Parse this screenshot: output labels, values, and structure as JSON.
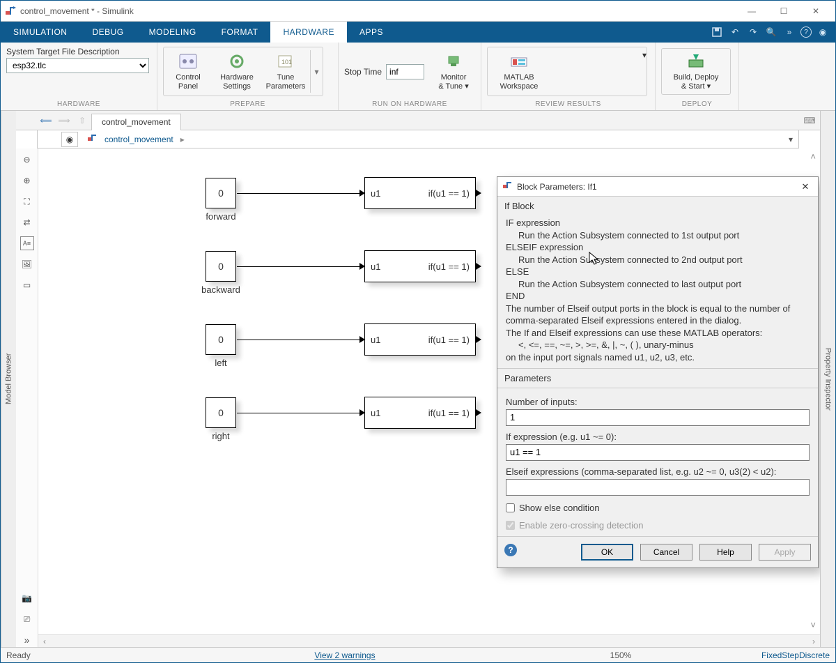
{
  "titlebar": {
    "title": "control_movement * - Simulink"
  },
  "menubar": {
    "tabs": [
      "SIMULATION",
      "DEBUG",
      "MODELING",
      "FORMAT",
      "HARDWARE",
      "APPS"
    ],
    "active": 4
  },
  "ribbon": {
    "hardware": {
      "label": "HARDWARE",
      "field_label": "System Target File Description",
      "field_value": "esp32.tlc"
    },
    "prepare": {
      "label": "PREPARE",
      "btns": [
        {
          "t1": "Control",
          "t2": "Panel"
        },
        {
          "t1": "Hardware",
          "t2": "Settings"
        },
        {
          "t1": "Tune",
          "t2": "Parameters"
        }
      ]
    },
    "run": {
      "label": "RUN ON HARDWARE",
      "stop_label": "Stop Time",
      "stop_value": "inf",
      "monitor": {
        "t1": "Monitor",
        "t2": "& Tune"
      }
    },
    "review": {
      "label": "REVIEW RESULTS",
      "matlab": {
        "t1": "MATLAB",
        "t2": "Workspace"
      }
    },
    "deploy": {
      "label": "DEPLOY",
      "btn": {
        "t1": "Build, Deploy",
        "t2": "& Start"
      }
    }
  },
  "subbar": {
    "tab": "control_movement"
  },
  "crumbs": {
    "path": "control_movement"
  },
  "side": {
    "left": "Model Browser",
    "right": "Property Inspector"
  },
  "blocks": [
    {
      "val": "0",
      "label": "forward",
      "in": "u1",
      "cond": "if(u1 == 1)"
    },
    {
      "val": "0",
      "label": "backward",
      "in": "u1",
      "cond": "if(u1 == 1)"
    },
    {
      "val": "0",
      "label": "left",
      "in": "u1",
      "cond": "if(u1 == 1)"
    },
    {
      "val": "0",
      "label": "right",
      "in": "u1",
      "cond": "if(u1 == 1)"
    }
  ],
  "dialog": {
    "title": "Block Parameters: If1",
    "section": "If Block",
    "desc": {
      "l1": "IF expression",
      "l2": "Run the Action Subsystem connected to 1st output port",
      "l3": "ELSEIF expression",
      "l4": "Run the Action Subsystem connected to 2nd output port",
      "l5": "ELSE",
      "l6": "Run the Action Subsystem connected to last output port",
      "l7": "END",
      "l8": "The number of Elseif output ports in the block is equal to the number of comma-separated Elseif expressions entered in the dialog.",
      "l9": "The If and Elseif expressions can use these MATLAB operators:",
      "l10": "<, <=, ==, ~=, >, >=, &, |, ~, (  ), unary-minus",
      "l11": "on the input port signals named u1, u2, u3, etc."
    },
    "params_title": "Parameters",
    "num_label": "Number of inputs:",
    "num_value": "1",
    "if_label": "If expression (e.g. u1 ~= 0):",
    "if_value": "u1 == 1",
    "elseif_label": "Elseif expressions (comma-separated list, e.g. u2 ~= 0, u3(2) < u2):",
    "elseif_value": "",
    "show_else": "Show else condition",
    "zero_cross": "Enable zero-crossing detection",
    "ok": "OK",
    "cancel": "Cancel",
    "help": "Help",
    "apply": "Apply"
  },
  "status": {
    "ready": "Ready",
    "warn": "View 2 warnings",
    "zoom": "150%",
    "solver": "FixedStepDiscrete"
  }
}
